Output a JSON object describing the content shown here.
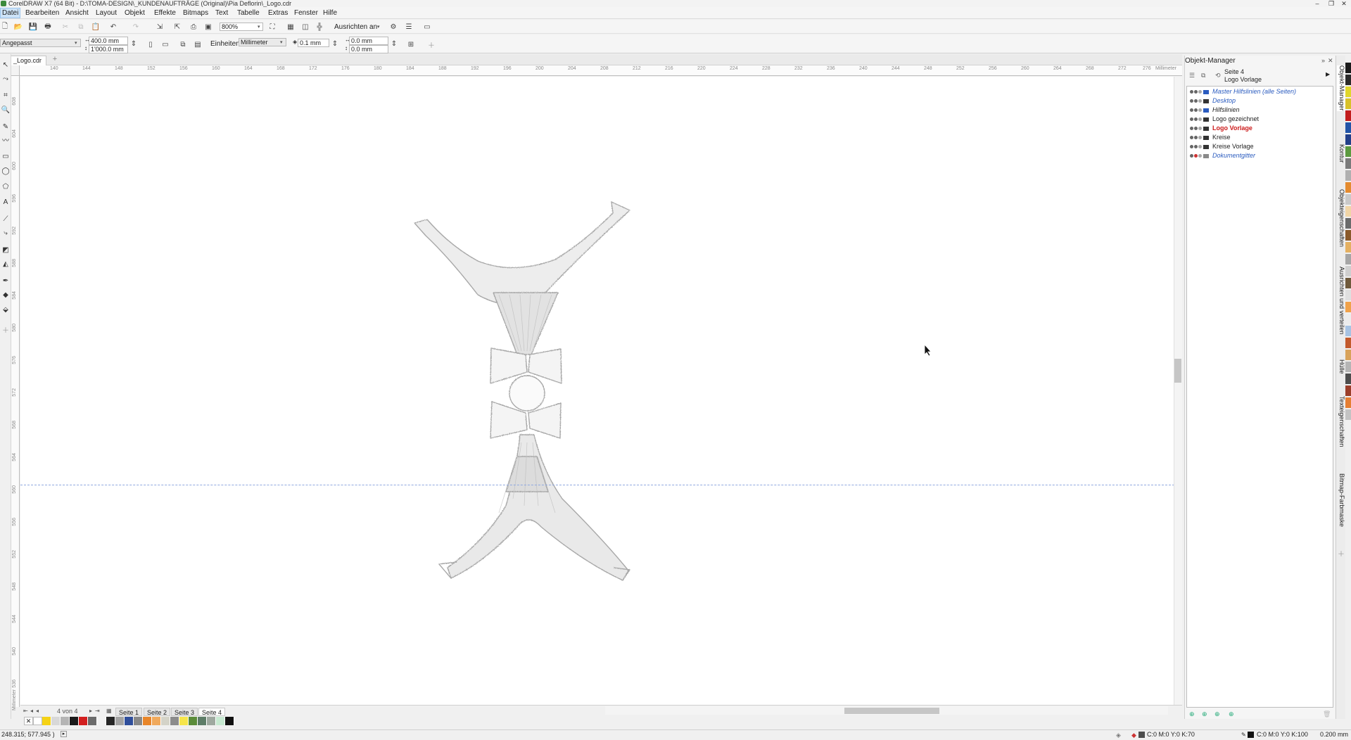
{
  "window": {
    "title": "CorelDRAW X7 (64 Bit) - D:\\TOMA-DESIGN\\_KUNDENAUFTRÄGE (Original)\\Pia Deflorin\\_Logo.cdr",
    "buttons": [
      "–",
      "❐",
      "✕"
    ]
  },
  "menu": {
    "items": [
      "Datei",
      "Bearbeiten",
      "Ansicht",
      "Layout",
      "Objekt",
      "Effekte",
      "Bitmaps",
      "Text",
      "Tabelle",
      "Extras",
      "Fenster",
      "Hilfe"
    ]
  },
  "standard_toolbar": {
    "zoom": "800%",
    "snap_label": "Ausrichten an"
  },
  "property_bar": {
    "preset": "Angepasst",
    "width": "400.0 mm",
    "height": "1'000.0 mm",
    "units_label": "Einheiten:",
    "units_value": "Millimeter",
    "nudge": "0.1 mm",
    "dup_x": "0.0 mm",
    "dup_y": "0.0 mm"
  },
  "document_tab": {
    "label": "_Logo.cdr",
    "add": "+"
  },
  "rulers": {
    "h_ticks": [
      "140",
      "144",
      "148",
      "152",
      "156",
      "160",
      "164",
      "168",
      "172",
      "176",
      "180",
      "184",
      "188",
      "192",
      "196",
      "200",
      "204",
      "208",
      "212",
      "216",
      "220",
      "224",
      "228",
      "232",
      "236",
      "240",
      "244",
      "248",
      "252",
      "256",
      "260",
      "264",
      "268",
      "272",
      "276"
    ],
    "h_unit": "Millimeter",
    "v_ticks": [
      "608",
      "604",
      "600",
      "596",
      "592",
      "588",
      "584",
      "580",
      "576",
      "572",
      "568",
      "564",
      "560",
      "556",
      "552",
      "548",
      "544",
      "540",
      "536"
    ],
    "v_unit": "Millimeter"
  },
  "page_nav": {
    "counter": "4 von 4",
    "pages": [
      "Seite 1",
      "Seite 2",
      "Seite 3",
      "Seite 4"
    ],
    "active": "Seite 4"
  },
  "palette_colors": [
    "#ffffff",
    "#f5d215",
    "#d8d8d8",
    "#b5b5b5",
    "#1a1a1a",
    "#d21f1f",
    "#6b6b6b",
    "#f1f1f1",
    "#262626",
    "#a3a3a3",
    "#2f4e9b",
    "#888888",
    "#e8862a",
    "#f0a95c",
    "#d4d3c8",
    "#8c8c8c",
    "#f6e54a",
    "#5b8c3a",
    "#5e7d68",
    "#9fa9a0",
    "#c7e9d1",
    "#111111"
  ],
  "status": {
    "coords": "248.315; 577.945 )",
    "fill": "C:0 M:0 Y:0 K:70",
    "outline": "C:0 M:0 Y:0 K:100",
    "outline_width": "0.200 mm"
  },
  "object_manager": {
    "title": "Objekt-Manager",
    "page": "Seite 4",
    "current_layer": "Logo Vorlage",
    "layers": [
      {
        "name": "Master Hilfslinien (alle Seiten)",
        "style": "italic"
      },
      {
        "name": "Desktop",
        "style": "italic"
      },
      {
        "name": "Hilfslinien",
        "style": "italic-dark"
      },
      {
        "name": "Logo gezeichnet",
        "style": "normal"
      },
      {
        "name": "Logo Vorlage",
        "style": "red"
      },
      {
        "name": "Kreise",
        "style": "normal"
      },
      {
        "name": "Kreise Vorlage",
        "style": "normal"
      },
      {
        "name": "Dokumentgitter",
        "style": "italic"
      }
    ]
  },
  "docker_tabs": [
    "Objekt-Manager",
    "Kontur",
    "Objekteigenschaften",
    "Ausrichten und verteilen",
    "Hülle",
    "Texteigenschaften",
    "Bitmap-Farbmaske"
  ],
  "right_palette": [
    "#1b1b1b",
    "#2b2b2b",
    "#e0d62c",
    "#d8c12a",
    "#c21d1d",
    "#2255a8",
    "#23408a",
    "#5c9a3f",
    "#7a7a7a",
    "#b0b0b0",
    "#e48b2f",
    "#c9c9c9",
    "#f1d5a6",
    "#6b6b6b",
    "#8a5a2b",
    "#e4b061",
    "#a5a5a5",
    "#cfcfcf",
    "#6f5a3c",
    "#dfdfdf",
    "#f0a24a",
    "#ececec",
    "#a7c3e3",
    "#c35a2c",
    "#d8a25a",
    "#b5b5b5",
    "#4d4d4d",
    "#9b3e2a",
    "#e57f33",
    "#c3c3c3"
  ]
}
